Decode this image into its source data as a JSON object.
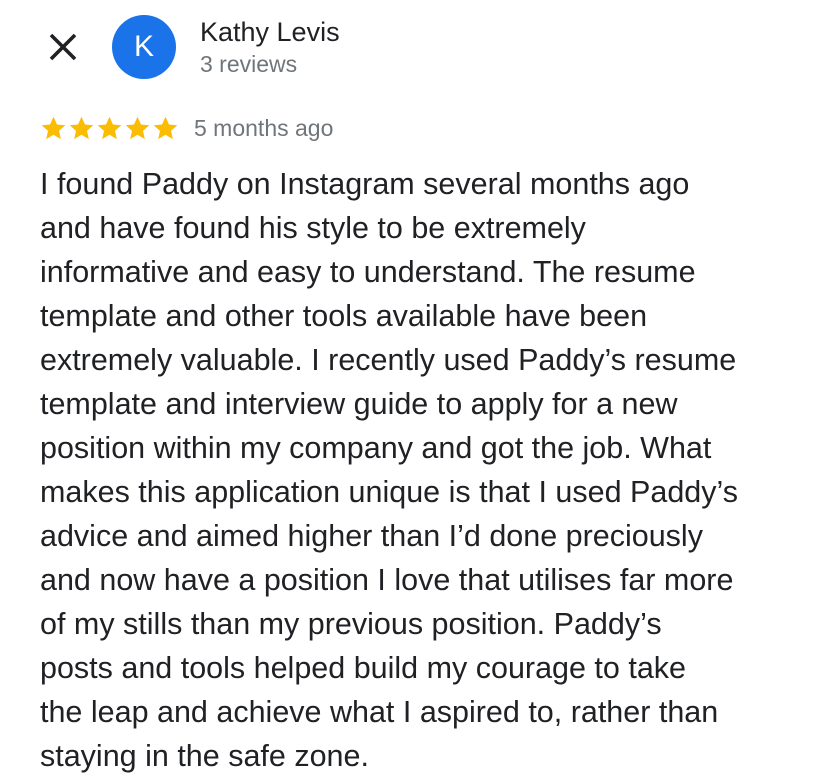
{
  "close_button": {
    "icon": "close-icon"
  },
  "reviewer": {
    "initial": "K",
    "avatar_color": "#1a73e8",
    "name": "Kathy Levis",
    "review_count": "3 reviews"
  },
  "review": {
    "rating": 5,
    "rating_max": 5,
    "star_color": "#fbbc04",
    "timestamp": "5 months ago",
    "lines": [
      "I found Paddy on Instagram several months ago",
      "and have found his style to be extremely",
      "informative and easy to understand. The resume",
      "template and other tools available have been",
      "extremely valuable. I recently used Paddy’s resume",
      "template and interview guide to apply for a new",
      "position within my company and got the job. What",
      "makes this application unique is that I used Paddy’s",
      "advice and aimed higher than I’d done preciously",
      "and now have a position I love that utilises far more",
      "of my stills than my previous position. Paddy’s",
      "posts and tools helped build my courage to take",
      "the leap and achieve what I aspired to, rather than",
      "staying in the safe zone."
    ]
  }
}
